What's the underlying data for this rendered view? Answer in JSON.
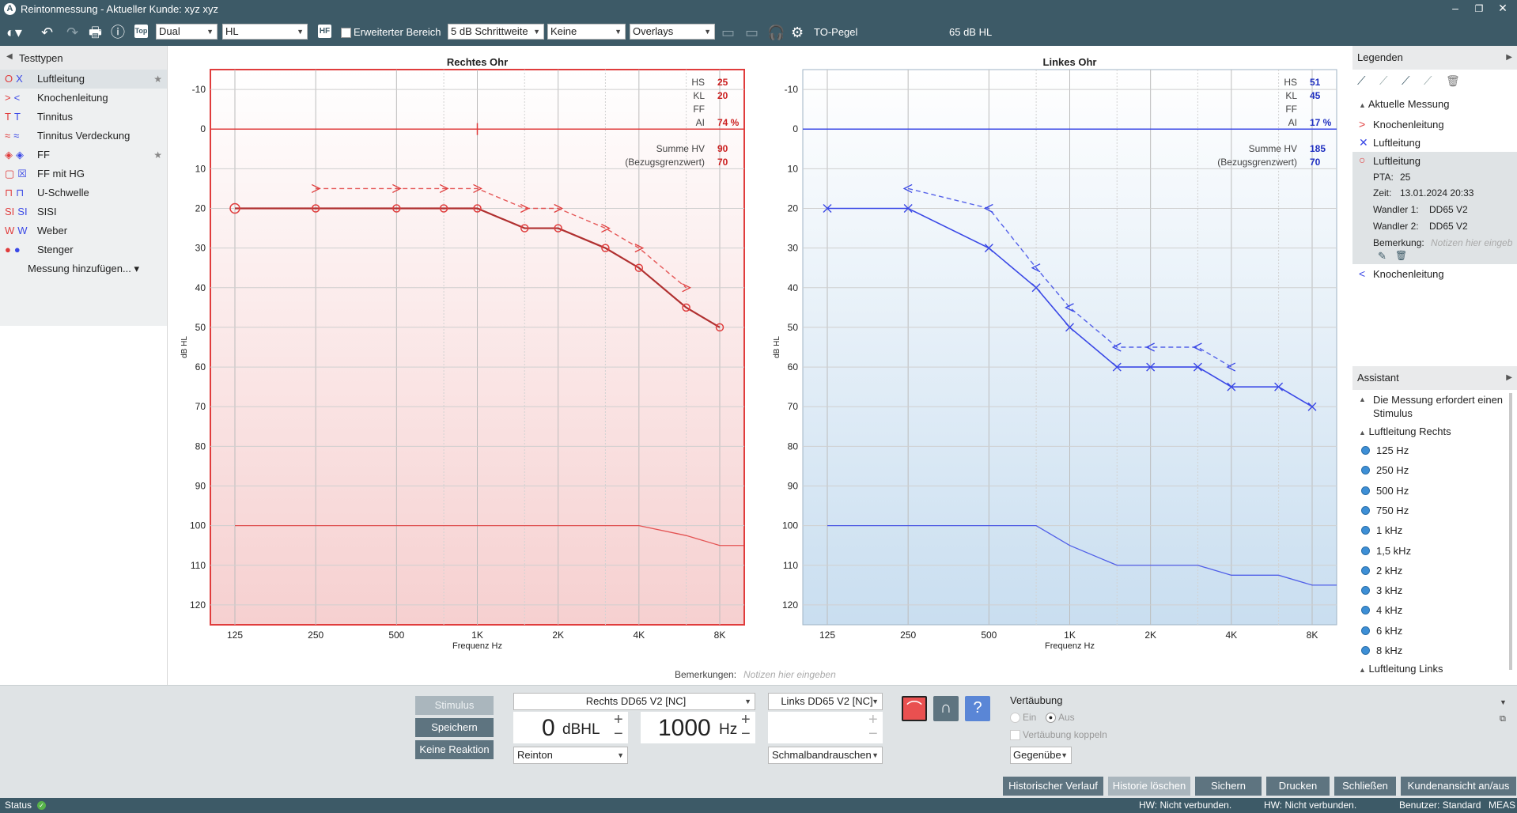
{
  "window": {
    "title": "Reintonmessung - Aktueller Kunde: xyz xyz",
    "logo": "A"
  },
  "toolbar": {
    "mode_select": "Dual",
    "unit_select": "HL",
    "hf_label": "HF",
    "top_label": "Top",
    "extended_range_label": "Erweiterter Bereich",
    "step_select": "5 dB Schrittweite",
    "masking_select": "Keine",
    "overlays_select": "Overlays",
    "to_level_label": "TO-Pegel",
    "to_level_value": "65 dB HL",
    "to_level_fraction": 0.5
  },
  "left_panel": {
    "title": "Testtypen",
    "items": [
      {
        "label": "Luftleitung",
        "icon": "OX",
        "selected": true,
        "star": true
      },
      {
        "label": "Knochenleitung",
        "icon": "> <"
      },
      {
        "label": "Tinnitus",
        "icon": "T T"
      },
      {
        "label": "Tinnitus Verdeckung",
        "icon": "≈ ≈"
      },
      {
        "label": "FF",
        "icon": "◈ ◈",
        "star": true
      },
      {
        "label": "FF mit HG",
        "icon": "▢ ☒"
      },
      {
        "label": "U-Schwelle",
        "icon": "⊓ ⊓"
      },
      {
        "label": "SISI",
        "icon": "SI SI"
      },
      {
        "label": "Weber",
        "icon": "W W"
      },
      {
        "label": "Stenger",
        "icon": "● ●"
      }
    ],
    "add_measurement": "Messung hinzufügen..."
  },
  "right_chart": {
    "title": "Rechtes Ohr",
    "xlabel": "Frequenz Hz",
    "ylabel": "dB HL",
    "yticks": [
      "-10",
      "0",
      "10",
      "20",
      "30",
      "40",
      "50",
      "60",
      "70",
      "80",
      "90",
      "100",
      "110",
      "120"
    ],
    "xticks": [
      "125",
      "250",
      "500",
      "1K",
      "2K",
      "4K",
      "8K"
    ],
    "stats": [
      {
        "label": "HS",
        "value": "25"
      },
      {
        "label": "KL",
        "value": "20"
      },
      {
        "label": "FF",
        "value": ""
      },
      {
        "label": "AI",
        "value": "74 %"
      }
    ],
    "sum_label": "Summe HV",
    "sum_value": "90",
    "ref_label": "(Bezugsgrenzwert)",
    "ref_value": "70"
  },
  "left_chart": {
    "title": "Linkes Ohr",
    "xlabel": "Frequenz Hz",
    "ylabel": "dB HL",
    "yticks": [
      "-10",
      "0",
      "10",
      "20",
      "30",
      "40",
      "50",
      "60",
      "70",
      "80",
      "90",
      "100",
      "110",
      "120"
    ],
    "xticks": [
      "125",
      "250",
      "500",
      "1K",
      "2K",
      "4K",
      "8K"
    ],
    "stats": [
      {
        "label": "HS",
        "value": "51"
      },
      {
        "label": "KL",
        "value": "45"
      },
      {
        "label": "FF",
        "value": ""
      },
      {
        "label": "AI",
        "value": "17 %"
      }
    ],
    "sum_label": "Summe HV",
    "sum_value": "185",
    "ref_label": "(Bezugsgrenzwert)",
    "ref_value": "70"
  },
  "chart_data": [
    {
      "type": "line",
      "title": "Rechtes Ohr",
      "xlabel": "Frequenz Hz",
      "ylabel": "dB HL",
      "x_scale": "log2",
      "xlim": [
        125,
        8000
      ],
      "ylim": [
        -15,
        125
      ],
      "y_inverted": true,
      "color": "#e03c3c",
      "series": [
        {
          "name": "Luftleitung",
          "x": [
            125,
            250,
            500,
            750,
            1000,
            1500,
            2000,
            3000,
            4000,
            6000,
            8000
          ],
          "y": [
            20,
            20,
            20,
            20,
            20,
            25,
            25,
            30,
            35,
            45,
            50
          ]
        },
        {
          "name": "Knochenleitung",
          "x": [
            250,
            500,
            750,
            1000,
            1500,
            2000,
            3000,
            4000,
            6000
          ],
          "y": [
            15,
            15,
            15,
            15,
            20,
            20,
            25,
            30,
            40
          ]
        },
        {
          "x": [
            125,
            4000,
            6000,
            8000,
            10000
          ],
          "y": [
            100,
            100,
            102.5,
            105,
            105
          ]
        },
        {
          "x": [
            125,
            10000
          ],
          "y": [
            0,
            0
          ]
        }
      ]
    },
    {
      "type": "line",
      "title": "Linkes Ohr",
      "xlabel": "Frequenz Hz",
      "ylabel": "dB HL",
      "x_scale": "log2",
      "xlim": [
        125,
        8000
      ],
      "ylim": [
        -15,
        125
      ],
      "y_inverted": true,
      "color": "#3a48e6",
      "series": [
        {
          "name": "Luftleitung",
          "x": [
            125,
            250,
            500,
            750,
            1000,
            1500,
            2000,
            3000,
            4000,
            6000,
            8000
          ],
          "y": [
            20,
            20,
            30,
            40,
            50,
            60,
            60,
            60,
            65,
            65,
            70
          ]
        },
        {
          "name": "Knochenleitung",
          "x": [
            250,
            500,
            750,
            1000,
            1500,
            2000,
            3000,
            4000
          ],
          "y": [
            15,
            20,
            35,
            45,
            55,
            55,
            55,
            60
          ]
        },
        {
          "x": [
            125,
            750,
            1000,
            1500,
            3000,
            4000,
            6000,
            8000,
            10000
          ],
          "y": [
            100,
            100,
            105,
            110,
            110,
            112.5,
            112.5,
            115,
            115
          ]
        },
        {
          "x": [
            125,
            10000
          ],
          "y": [
            0,
            0
          ]
        }
      ]
    }
  ],
  "legend_panel": {
    "title": "Legenden",
    "section": "Aktuelle Messung",
    "items": [
      {
        "label": "Knochenleitung",
        "icon": ">"
      },
      {
        "label": "Luftleitung",
        "icon": "X"
      },
      {
        "label": "Luftleitung",
        "icon": "O"
      }
    ],
    "details": [
      {
        "label": "PTA:",
        "value": "25"
      },
      {
        "label": "Zeit:",
        "value": "13.01.2024 20:33"
      },
      {
        "label": "Wandler 1:",
        "value": "DD65 V2"
      },
      {
        "label": "Wandler 2:",
        "value": "DD65 V2"
      }
    ],
    "remark_label": "Bemerkung:",
    "remark_placeholder": "Notizen hier eingeb",
    "last_item": {
      "label": "Knochenleitung",
      "icon": "<"
    }
  },
  "assistant_panel": {
    "title": "Assistant",
    "message": "Die Messung erfordert einen Stimulus",
    "group1": "Luftleitung  Rechts",
    "freqs": [
      "125 Hz",
      "250 Hz",
      "500 Hz",
      "750 Hz",
      "1 kHz",
      "1,5 kHz",
      "2 kHz",
      "3 kHz",
      "4 kHz",
      "6 kHz",
      "8 kHz"
    ],
    "group2": "Luftleitung  Links"
  },
  "remarks": {
    "label": "Bemerkungen:",
    "placeholder": "Notizen hier eingeben"
  },
  "controls": {
    "stimulus": "Stimulus",
    "save": "Speichern",
    "no_reaction": "Keine Reaktion",
    "right_transducer": "Rechts DD65 V2 [NC]",
    "left_transducer": "Links DD65 V2 [NC]",
    "level_value": "0",
    "level_unit": "dBHL",
    "freq_value": "1000",
    "freq_unit": "Hz",
    "signal_type": "Reinton",
    "noise_type": "Schmalbandrauschen",
    "masking_title": "Vertäubung",
    "on_label": "Ein",
    "off_label": "Aus",
    "couple_label": "Vertäubung koppeln",
    "side_select": "Gegenübe"
  },
  "footer": {
    "buttons": [
      "Historischer Verlauf",
      "Historie löschen",
      "Sichern",
      "Drucken",
      "Schließen",
      "Kundenansicht an/aus"
    ]
  },
  "status": {
    "label": "Status",
    "hw1": "HW:  Nicht verbunden.",
    "hw2": "HW:  Nicht verbunden.",
    "user": "Benutzer: Standard",
    "meas": "MEAS"
  },
  "colors": {
    "bar": "#3d5a67",
    "right": "#e03c3c",
    "left": "#3a48e6"
  }
}
